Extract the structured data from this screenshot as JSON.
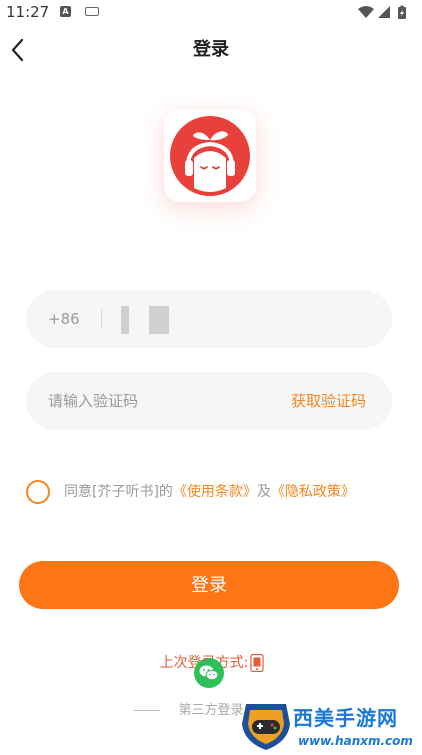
{
  "status_bar": {
    "time": "11:27",
    "icons": [
      "a-notification-icon",
      "keyboard-icon",
      "wifi-icon",
      "signal-icon",
      "battery-charging-icon"
    ]
  },
  "nav": {
    "title": "登录",
    "back_icon": "chevron-left-icon"
  },
  "logo": {
    "name": "芥子听书",
    "bg_color": "#e8403a",
    "sprout_color": "#ffffff"
  },
  "phone_field": {
    "country_code": "+86",
    "value": ""
  },
  "code_field": {
    "placeholder": "请输入验证码",
    "get_code_label": "获取验证码"
  },
  "agreement": {
    "checked": false,
    "prefix": "同意[芥子听书]的",
    "terms_link": "《使用条款》",
    "conjunction": "及",
    "privacy_link": "《隐私政策》"
  },
  "login_button": {
    "label": "登录"
  },
  "last_login": {
    "label": "上次登录方式:"
  },
  "third_party": {
    "label": "第三方登录"
  },
  "watermark": {
    "title": "西美手游网",
    "url": "www.hanxm.com"
  },
  "colors": {
    "accent": "#fd7514",
    "link": "#f5861f",
    "last_login": "#e65a36",
    "wechat": "#2ec15a",
    "field_bg": "#f6f6f6"
  }
}
